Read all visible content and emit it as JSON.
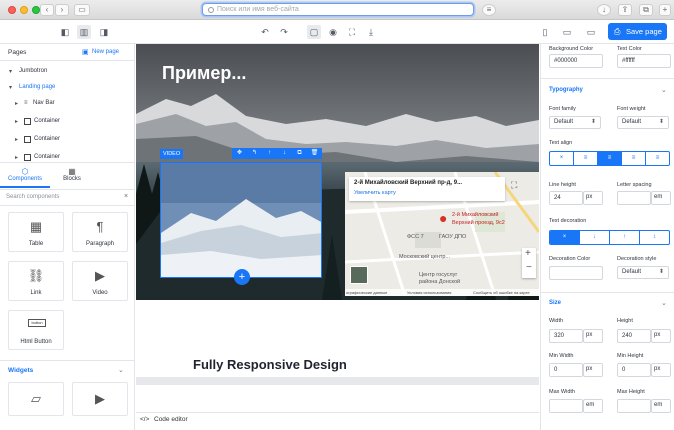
{
  "browser": {
    "address_placeholder": "Поиск или имя веб-сайта"
  },
  "toolbar": {
    "save_label": "Save page"
  },
  "left": {
    "pages_label": "Pages",
    "new_page_label": "New page",
    "tree": [
      {
        "label": "Jumbotron"
      },
      {
        "label": "Landing page"
      },
      {
        "label": "Nav Bar"
      },
      {
        "label": "Container"
      },
      {
        "label": "Container"
      },
      {
        "label": "Container"
      }
    ],
    "tabs": {
      "components": "Components",
      "blocks": "Blocks"
    },
    "search_placeholder": "Search components",
    "components": [
      {
        "label": "Table",
        "icon": "table-icon"
      },
      {
        "label": "Paragraph",
        "icon": "paragraph-icon"
      },
      {
        "label": "Link",
        "icon": "link-icon"
      },
      {
        "label": "Video",
        "icon": "video-icon"
      },
      {
        "label": "Html Button",
        "icon": "html-button-icon"
      }
    ],
    "widgets_label": "Widgets",
    "button_icon_text": "button"
  },
  "canvas": {
    "hero_title": "Пример...",
    "video_tag": "VIDEO",
    "map": {
      "address": "2-й Михайловский Верхний пр-д, 9...",
      "link": "Увеличить карту",
      "pin_label_1": "2-й Михайловский",
      "pin_label_2": "Верхний проезд, 9с2",
      "poi_1": "ФСС 7",
      "poi_2": "ГАОУ ДПО",
      "poi_3": "Московский центр...",
      "poi_4": "Центр госуслуг",
      "poi_5": "района Донской",
      "footer_1": "ографические данные",
      "footer_2": "Условия использования",
      "footer_3": "Сообщить об ошибке на карте"
    },
    "section_title": "Fully Responsive Design"
  },
  "codebar": {
    "label": "Code editor"
  },
  "right": {
    "background_color_label": "Background Color",
    "background_color_value": "#000000",
    "text_color_label": "Text Color",
    "text_color_value": "#ffffff",
    "typography_label": "Typography",
    "font_family_label": "Font family",
    "font_family_value": "Default",
    "font_weight_label": "Font weight",
    "font_weight_value": "Default",
    "text_align_label": "Text align",
    "line_height_label": "Line height",
    "line_height_value": "24",
    "line_height_unit": "px",
    "letter_spacing_label": "Letter spacing",
    "letter_spacing_unit": "em",
    "text_decoration_label": "Text decoration",
    "decoration_color_label": "Decoration Color",
    "decoration_style_label": "Decoration style",
    "decoration_style_value": "Default",
    "size_label": "Size",
    "width_label": "Width",
    "width_value": "320",
    "width_unit": "px",
    "height_label": "Height",
    "height_value": "240",
    "height_unit": "px",
    "min_width_label": "Min Width",
    "min_width_value": "0",
    "min_width_unit": "px",
    "min_height_label": "Min Height",
    "min_height_value": "0",
    "min_height_unit": "px",
    "max_width_label": "Max Width",
    "max_width_unit": "em",
    "max_height_label": "Max Height",
    "max_height_unit": "em"
  },
  "colors": {
    "accent": "#1976f7",
    "panel_border": "#e3e5ea"
  }
}
